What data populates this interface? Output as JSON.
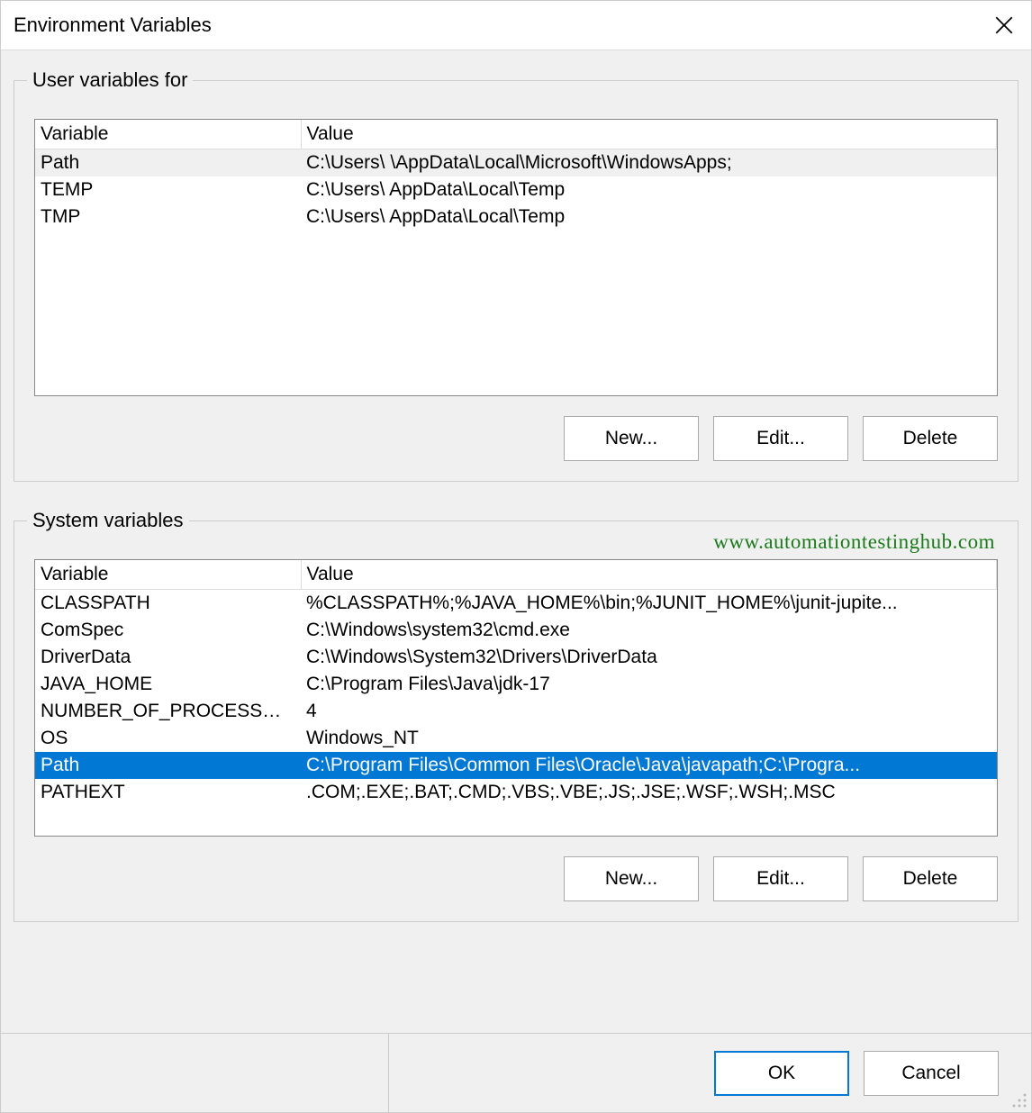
{
  "dialog": {
    "title": "Environment Variables"
  },
  "user_section": {
    "legend": "User variables for",
    "columns": {
      "variable": "Variable",
      "value": "Value"
    },
    "rows": [
      {
        "variable": "Path",
        "value": "C:\\Users\\                       \\AppData\\Local\\Microsoft\\WindowsApps;"
      },
      {
        "variable": "TEMP",
        "value": "C:\\Users\\                        AppData\\Local\\Temp"
      },
      {
        "variable": "TMP",
        "value": "C:\\Users\\                        AppData\\Local\\Temp"
      }
    ],
    "buttons": {
      "new": "New...",
      "edit": "Edit...",
      "delete": "Delete"
    }
  },
  "system_section": {
    "legend": "System variables",
    "columns": {
      "variable": "Variable",
      "value": "Value"
    },
    "rows": [
      {
        "variable": "CLASSPATH",
        "value": "%CLASSPATH%;%JAVA_HOME%\\bin;%JUNIT_HOME%\\junit-jupite..."
      },
      {
        "variable": "ComSpec",
        "value": "C:\\Windows\\system32\\cmd.exe"
      },
      {
        "variable": "DriverData",
        "value": "C:\\Windows\\System32\\Drivers\\DriverData"
      },
      {
        "variable": "JAVA_HOME",
        "value": "C:\\Program Files\\Java\\jdk-17"
      },
      {
        "variable": "NUMBER_OF_PROCESSORS",
        "value": "4"
      },
      {
        "variable": "OS",
        "value": "Windows_NT"
      },
      {
        "variable": "Path",
        "value": "C:\\Program Files\\Common Files\\Oracle\\Java\\javapath;C:\\Progra..."
      },
      {
        "variable": "PATHEXT",
        "value": ".COM;.EXE;.BAT;.CMD;.VBS;.VBE;.JS;.JSE;.WSF;.WSH;.MSC"
      }
    ],
    "selected_index": 6,
    "buttons": {
      "new": "New...",
      "edit": "Edit...",
      "delete": "Delete"
    }
  },
  "footer": {
    "ok": "OK",
    "cancel": "Cancel"
  },
  "watermark": "www.automationtestinghub.com"
}
